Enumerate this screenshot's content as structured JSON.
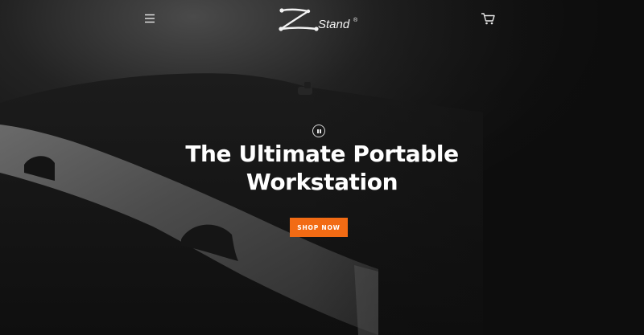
{
  "brand": {
    "name": "Stand",
    "registered_mark": "®",
    "logo_icon": "z-stand-logo-icon"
  },
  "header": {
    "menu_icon": "hamburger-menu-icon",
    "cart_icon": "shopping-cart-icon"
  },
  "hero": {
    "headline_line1": "The Ultimate Portable",
    "headline_line2": "Workstation",
    "cta_label": "SHOP NOW",
    "slideshow_control_icon": "pause-icon"
  },
  "colors": {
    "background": "#0c0c0c",
    "accent": "#f26b14",
    "text": "#ffffff"
  }
}
